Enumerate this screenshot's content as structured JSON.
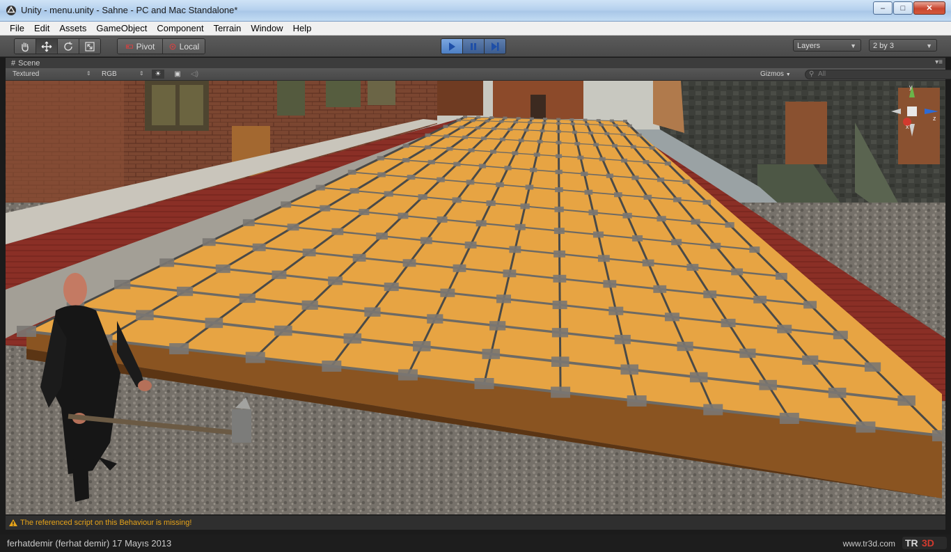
{
  "window": {
    "title": "Unity - menu.unity - Sahne - PC and Mac Standalone*",
    "minimize": "–",
    "maximize": "□",
    "close": "✕"
  },
  "menu": [
    "File",
    "Edit",
    "Assets",
    "GameObject",
    "Component",
    "Terrain",
    "Window",
    "Help"
  ],
  "toolbar": {
    "tools": [
      "hand-icon",
      "move-icon",
      "rotate-icon",
      "scale-icon"
    ],
    "active_tool": "move-icon",
    "pivot_label": "Pivot",
    "local_label": "Local",
    "play": "play-icon",
    "pause": "pause-icon",
    "step": "step-icon",
    "layers_label": "Layers",
    "layout_label": "2 by 3"
  },
  "scene_view": {
    "tab_label": "Scene",
    "render_mode": "Textured",
    "color_mode": "RGB",
    "gizmos_label": "Gizmos",
    "search_placeholder": "All",
    "gizmo_axes": [
      "y",
      "x",
      "z"
    ]
  },
  "status": {
    "message": "The referenced script on this Behaviour is missing!",
    "color": "#e6a31a"
  },
  "footer": {
    "author": "ferhatdemir (ferhat demir)  17 Mayıs 2013",
    "site": "www.tr3d.com",
    "logo_text": "TR3D"
  },
  "colors": {
    "play_active": "#4d7fc4",
    "scene_bg": "#3c3c3c",
    "wood": "#e7a443",
    "brick": "#7a3a28"
  }
}
